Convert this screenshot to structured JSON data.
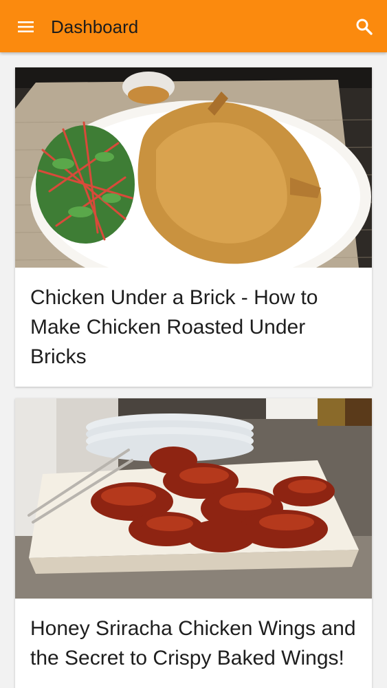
{
  "app_bar": {
    "title": "Dashboard",
    "background_color": "#fb8a0e",
    "menu_icon": "hamburger-menu-icon",
    "search_icon": "search-icon"
  },
  "cards": [
    {
      "title": "Chicken Under a Brick - How to Make Chicken Roasted Under Bricks",
      "image": "roasted-chicken-photo"
    },
    {
      "title": "Honey Sriracha Chicken Wings and the Secret to Crispy Baked Wings!",
      "image": "chicken-wings-photo"
    }
  ]
}
